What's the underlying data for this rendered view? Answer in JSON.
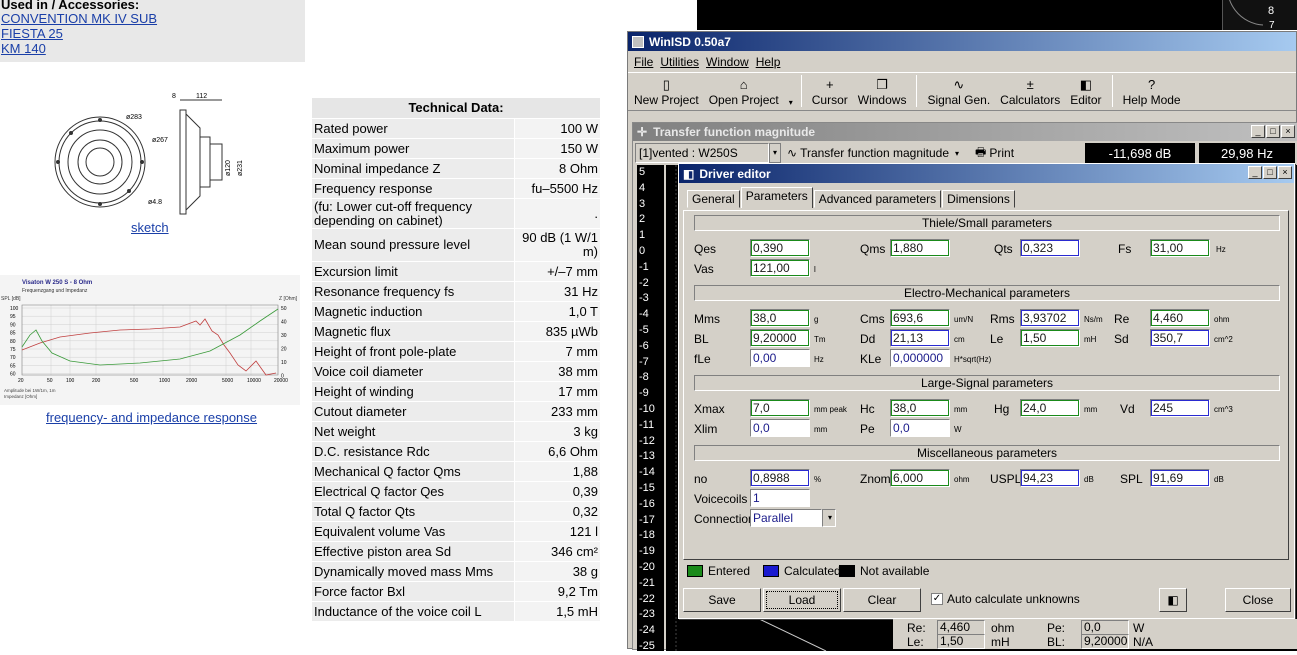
{
  "used_in": {
    "heading": "Used in / Accessories:",
    "links": [
      "CONVENTION MK IV SUB",
      "FIESTA 25",
      "KM 140"
    ]
  },
  "sketch_link": "sketch",
  "sketch_dims": {
    "d283": "ø283",
    "d267": "ø267",
    "d120": "ø120",
    "d231": "ø231",
    "d48": "ø4.8",
    "w112": "112",
    "w8": "8"
  },
  "graph": {
    "title": "Visaton W 250 S - 8 Ohm",
    "subtitle": "Frequenzgang und Impedanz",
    "left_axis": "SPL [dB]",
    "right_axis": "Z [Ohm]",
    "legend1": "Amplitude bei 1W/1m, 1m",
    "legend2": "Impedanz [Ohm]",
    "x_ticks": [
      "20",
      "50",
      "100",
      "200",
      "500",
      "1000",
      "2000",
      "5000",
      "10000",
      "20000"
    ],
    "y_ticks": [
      "100",
      "95",
      "90",
      "85",
      "80",
      "75",
      "70",
      "65",
      "60"
    ],
    "z_ticks": [
      "50",
      "40",
      "30",
      "20",
      "10",
      "0"
    ]
  },
  "graph_link": "frequency- and impedance response",
  "tech": {
    "title": "Technical Data:",
    "rows": [
      {
        "k": "Rated power",
        "v": "100 W"
      },
      {
        "k": "Maximum power",
        "v": "150 W"
      },
      {
        "k": "Nominal impedance Z",
        "v": "8 Ohm"
      },
      {
        "k": "Frequency response",
        "v": "fu–5500 Hz"
      },
      {
        "k": "(fu: Lower cut-off frequency depending on cabinet)",
        "v": "."
      },
      {
        "k": "Mean sound pressure level",
        "v": "90 dB (1 W/1 m)"
      },
      {
        "k": "Excursion limit",
        "v": "+/–7 mm"
      },
      {
        "k": "Resonance frequency fs",
        "v": "31 Hz"
      },
      {
        "k": "Magnetic induction",
        "v": "1,0 T"
      },
      {
        "k": "Magnetic flux",
        "v": "835 µWb"
      },
      {
        "k": "Height of front pole-plate",
        "v": "7 mm"
      },
      {
        "k": "Voice coil diameter",
        "v": "38 mm"
      },
      {
        "k": "Height of winding",
        "v": "17 mm"
      },
      {
        "k": "Cutout diameter",
        "v": "233 mm"
      },
      {
        "k": "Net weight",
        "v": "3 kg"
      },
      {
        "k": "D.C. resistance Rdc",
        "v": "6,6 Ohm"
      },
      {
        "k": "Mechanical Q factor Qms",
        "v": "1,88"
      },
      {
        "k": "Electrical Q factor Qes",
        "v": "0,39"
      },
      {
        "k": "Total Q factor Qts",
        "v": "0,32"
      },
      {
        "k": "Equivalent volume Vas",
        "v": "121 l"
      },
      {
        "k": "Effective piston area Sd",
        "v": "346 cm²"
      },
      {
        "k": "Dynamically moved mass Mms",
        "v": "38 g"
      },
      {
        "k": "Force factor Bxl",
        "v": "9,2 Tm"
      },
      {
        "k": "Inductance of the voice coil L",
        "v": "1,5 mH"
      }
    ]
  },
  "bg_gauge": "8",
  "bg_gauge2": "7",
  "winisd": {
    "title": "WinISD 0.50a7",
    "menu": [
      "File",
      "Utilities",
      "Window",
      "Help"
    ],
    "toolbar": [
      {
        "label": "New Project",
        "icon": "new-project-icon",
        "glyph": "▯"
      },
      {
        "label": "Open Project",
        "icon": "open-project-icon",
        "glyph": "⌂"
      },
      {
        "label": "Cursor",
        "icon": "cursor-icon",
        "glyph": "+"
      },
      {
        "label": "Windows",
        "icon": "windows-icon",
        "glyph": "❐"
      },
      {
        "label": "Signal Gen.",
        "icon": "signal-gen-icon",
        "glyph": "∿"
      },
      {
        "label": "Calculators",
        "icon": "calculators-icon",
        "glyph": "±"
      },
      {
        "label": "Editor",
        "icon": "editor-icon",
        "glyph": "◧"
      },
      {
        "label": "Help Mode",
        "icon": "help-mode-icon",
        "glyph": "?"
      }
    ],
    "tf": {
      "title": "Transfer function magnitude",
      "project_combo": "[1]vented : W250S",
      "graph_combo": "Transfer function magnitude",
      "print": "Print",
      "db_readout": "-11,698 dB",
      "hz_readout": "29,98 Hz",
      "y_ticks": [
        "5",
        "4",
        "3",
        "2",
        "1",
        "0",
        "-1",
        "-2",
        "-3",
        "-4",
        "-5",
        "-6",
        "-7",
        "-8",
        "-9",
        "-10",
        "-11",
        "-12",
        "-13",
        "-14",
        "-15",
        "-16",
        "-17",
        "-18",
        "-19",
        "-20",
        "-21",
        "-22",
        "-23",
        "-24",
        "-25"
      ]
    }
  },
  "driver_editor": {
    "title": "Driver editor",
    "tabs": [
      "General",
      "Parameters",
      "Advanced parameters",
      "Dimensions"
    ],
    "sections": {
      "ts": "Thiele/Small parameters",
      "em": "Electro-Mechanical parameters",
      "ls": "Large-Signal parameters",
      "misc": "Miscellaneous parameters"
    },
    "fields": {
      "qes": {
        "label": "Qes",
        "value": "0,390"
      },
      "qms": {
        "label": "Qms",
        "value": "1,880"
      },
      "qts": {
        "label": "Qts",
        "value": "0,323"
      },
      "fs": {
        "label": "Fs",
        "value": "31,00",
        "unit": "Hz"
      },
      "vas": {
        "label": "Vas",
        "value": "121,00",
        "unit": "l"
      },
      "mms": {
        "label": "Mms",
        "value": "38,0",
        "unit": "g"
      },
      "cms": {
        "label": "Cms",
        "value": "693,6",
        "unit": "um/N"
      },
      "rms": {
        "label": "Rms",
        "value": "3,93702",
        "unit": "Ns/m"
      },
      "re": {
        "label": "Re",
        "value": "4,460",
        "unit": "ohm"
      },
      "bl": {
        "label": "BL",
        "value": "9,20000",
        "unit": "Tm"
      },
      "dd": {
        "label": "Dd",
        "value": "21,13",
        "unit": "cm"
      },
      "le": {
        "label": "Le",
        "value": "1,50",
        "unit": "mH"
      },
      "sd": {
        "label": "Sd",
        "value": "350,7",
        "unit": "cm^2"
      },
      "fle": {
        "label": "fLe",
        "value": "0,00",
        "unit": "Hz"
      },
      "kle": {
        "label": "KLe",
        "value": "0,000000",
        "unit": "H*sqrt(Hz)"
      },
      "xmax": {
        "label": "Xmax",
        "value": "7,0",
        "unit": "mm peak"
      },
      "hc": {
        "label": "Hc",
        "value": "38,0",
        "unit": "mm"
      },
      "hg": {
        "label": "Hg",
        "value": "24,0",
        "unit": "mm"
      },
      "vd": {
        "label": "Vd",
        "value": "245",
        "unit": "cm^3"
      },
      "xlim": {
        "label": "Xlim",
        "value": "0,0",
        "unit": "mm"
      },
      "pe": {
        "label": "Pe",
        "value": "0,0",
        "unit": "W"
      },
      "no": {
        "label": "no",
        "value": "0,8988",
        "unit": "%"
      },
      "znom": {
        "label": "Znom",
        "value": "6,000",
        "unit": "ohm"
      },
      "uspl": {
        "label": "USPL",
        "value": "94,23",
        "unit": "dB"
      },
      "spl": {
        "label": "SPL",
        "value": "91,69",
        "unit": "dB"
      },
      "voicecoils": {
        "label": "Voicecoils",
        "value": "1"
      },
      "connection": {
        "label": "Connection",
        "value": "Parallel"
      }
    },
    "legend": {
      "entered": "Entered",
      "calculated": "Calculated",
      "not_available": "Not available"
    },
    "colors": {
      "entered": "#1a8a1a",
      "calculated": "#1a1ad0",
      "not_available": "#000000"
    },
    "buttons": {
      "save": "Save",
      "load": "Load",
      "clear": "Clear",
      "close": "Close"
    },
    "auto_calc": "Auto calculate unknowns"
  },
  "bottom_info": {
    "re_label": "Re:",
    "re_value": "4,460",
    "re_unit": "ohm",
    "pe_label": "Pe:",
    "pe_value": "0,0",
    "pe_unit": "W",
    "le_label": "Le:",
    "le_value": "1,50",
    "le_unit": "mH",
    "bl_label": "BL:",
    "bl_value": "9,20000",
    "bl_unit": "N/A"
  }
}
